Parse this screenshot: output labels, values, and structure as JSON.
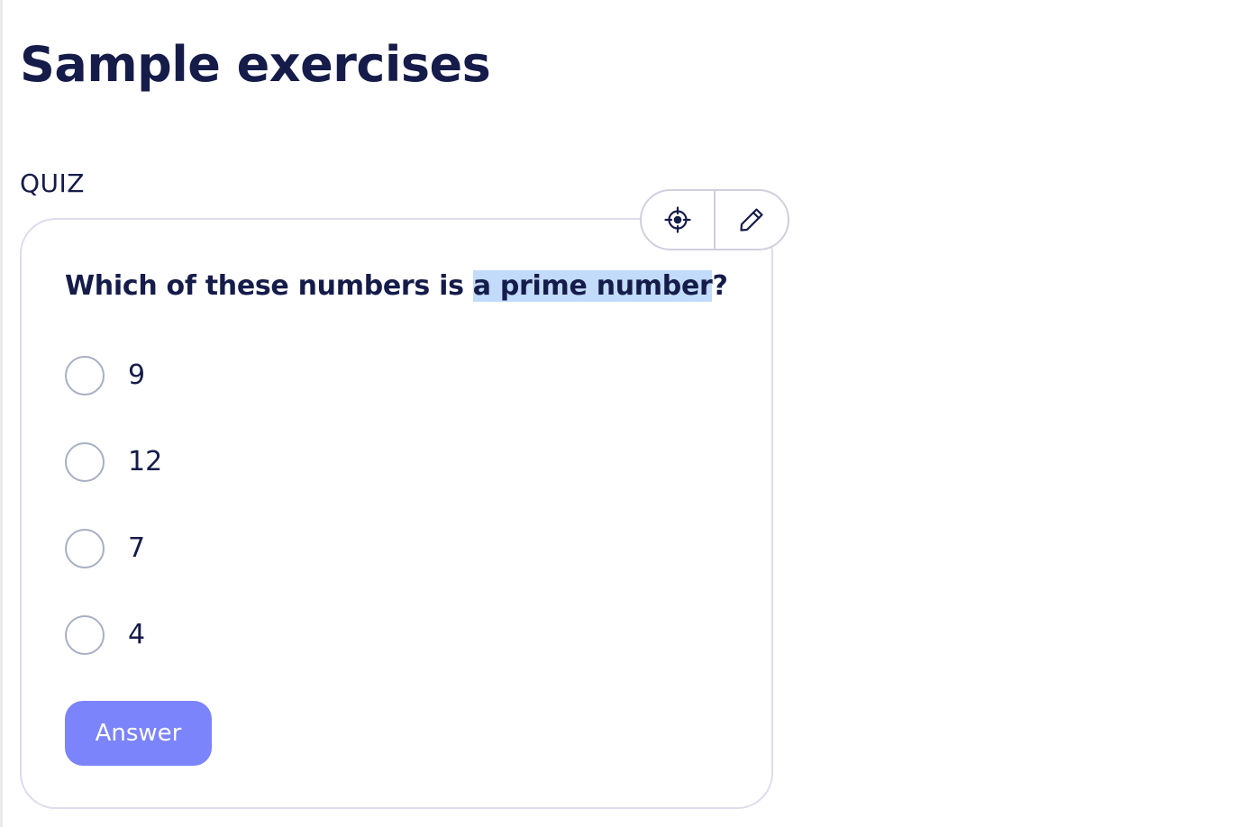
{
  "page": {
    "title": "Sample exercises"
  },
  "section": {
    "label": "QUIZ"
  },
  "toolbar": {
    "locate_icon": "crosshair-icon",
    "edit_icon": "pencil-icon"
  },
  "quiz": {
    "question_before": "Which of these numbers is ",
    "question_highlight": "a prime number",
    "question_after": "?",
    "options": [
      {
        "label": "9"
      },
      {
        "label": "12"
      },
      {
        "label": "7"
      },
      {
        "label": "4"
      }
    ],
    "answer_label": "Answer"
  },
  "colors": {
    "text": "#151c4a",
    "accent": "#7b84fa",
    "highlight": "#c2dbfa",
    "border": "#dcdcee"
  }
}
